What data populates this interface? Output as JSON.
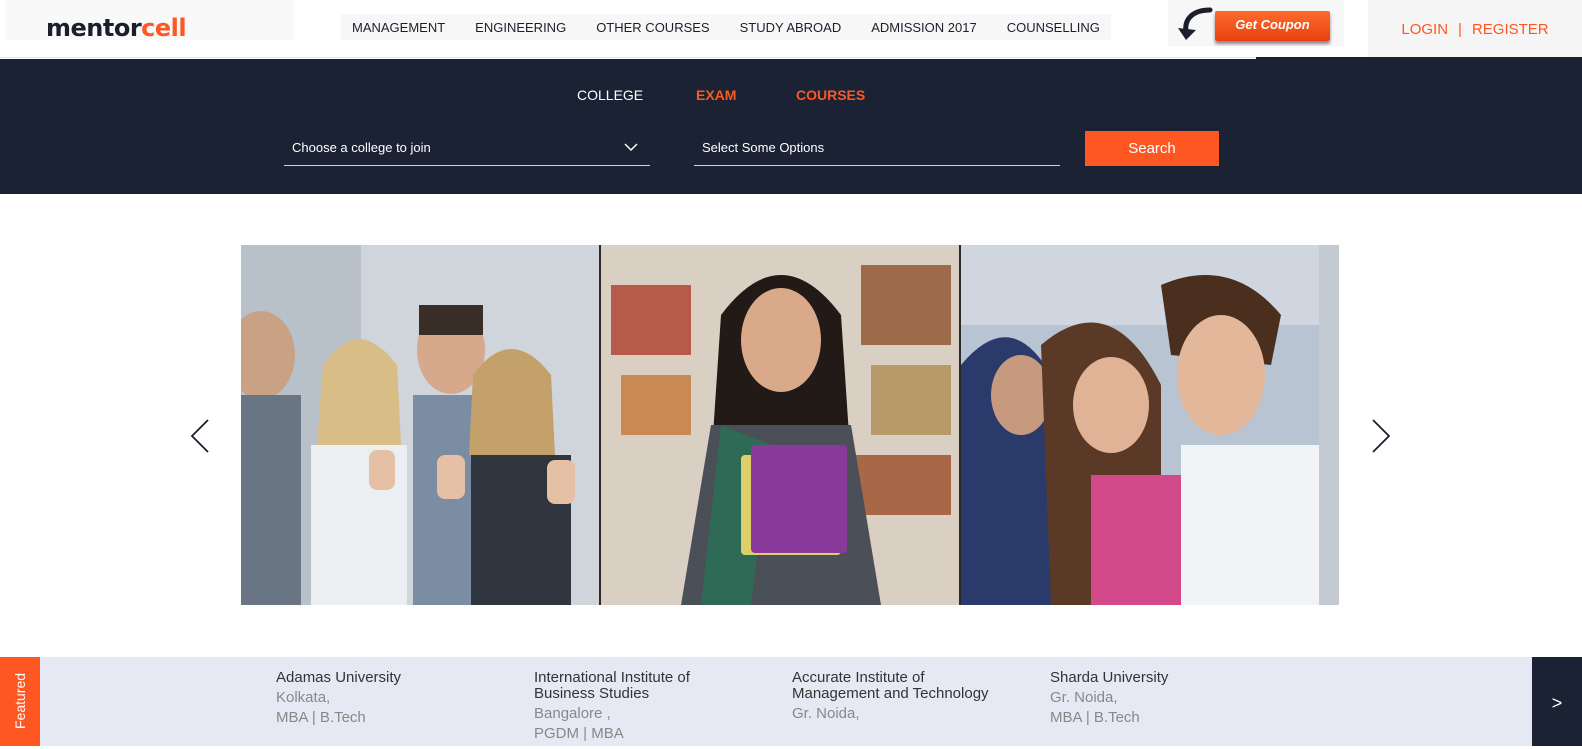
{
  "brand": {
    "logo_part1": "mentor",
    "logo_part2": "cell"
  },
  "nav": {
    "items": [
      {
        "label": "MANAGEMENT"
      },
      {
        "label": "ENGINEERING"
      },
      {
        "label": "OTHER COURSES"
      },
      {
        "label": "STUDY ABROAD"
      },
      {
        "label": "ADMISSION 2017"
      },
      {
        "label": "COUNSELLING"
      }
    ]
  },
  "coupon": {
    "label": "Get Coupon"
  },
  "auth": {
    "login": "LOGIN",
    "separator": "|",
    "register": "REGISTER"
  },
  "search": {
    "tabs": [
      {
        "label": "COLLEGE"
      },
      {
        "label": "EXAM"
      },
      {
        "label": "COURSES"
      }
    ],
    "college_select": "Choose a college to join",
    "options_select": "Select Some Options",
    "button": "Search"
  },
  "slider": {
    "panels": [
      {
        "icon": "group-thumbs-up-photo"
      },
      {
        "icon": "student-with-books-photo"
      },
      {
        "icon": "students-studying-photo"
      }
    ],
    "prev_icon": "chevron-left-icon",
    "next_icon": "chevron-right-icon"
  },
  "featured": {
    "label": "Featured",
    "next": ">",
    "colleges": [
      {
        "name": "Adamas University",
        "location": "Kolkata,",
        "courses": "MBA | B.Tech"
      },
      {
        "name": "International Institute of Business Studies",
        "location": "Bangalore ,",
        "courses": "PGDM | MBA"
      },
      {
        "name": "Accurate Institute of Management and Technology",
        "location": "Gr. Noida,",
        "courses": ""
      },
      {
        "name": "Sharda University",
        "location": "Gr. Noida,",
        "courses": "MBA | B.Tech"
      }
    ]
  },
  "colors": {
    "accent": "#ff5722",
    "navy": "#1a2233",
    "featured_bg": "#e6e9f4"
  }
}
